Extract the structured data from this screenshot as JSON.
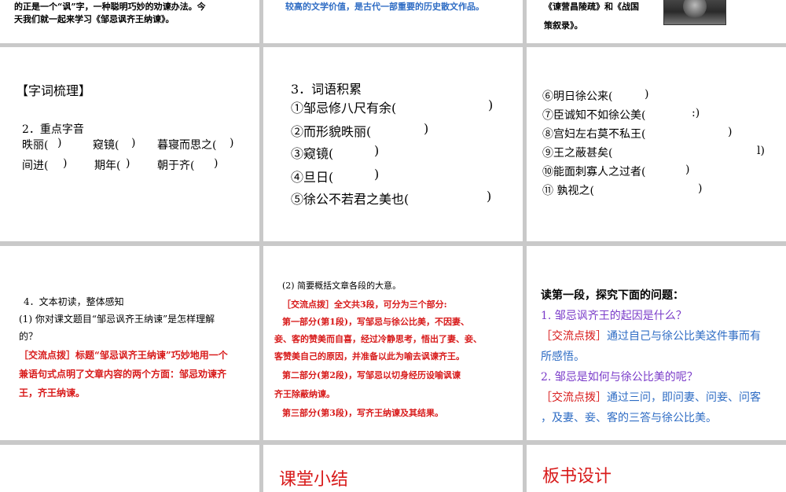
{
  "top_row": {
    "left_line1": "的正是一个“讽”字，一种聪明巧妙的劝谏办法。今",
    "left_line2": "天我们就一起来学习《邹忌讽齐王纳谏》。",
    "middle_line": "较高的文学价值，是古代一部重要的历史散文作品。",
    "right_line1": "《谏营昌陵疏》和《战国",
    "right_line2": "策叙录》。"
  },
  "slide_vocab_left": {
    "heading": "【字词梳理】",
    "sub": "2．重点字音",
    "row1": [
      "昳丽(",
      ")",
      "窥镜(",
      ")",
      "暮寝而思之(",
      ")"
    ],
    "row2": [
      "间进(",
      ")",
      "期年(",
      ")",
      "朝于齐(",
      ")"
    ]
  },
  "slide_vocab_mid": {
    "heading": "3．词语积累",
    "items": [
      "①邹忌修八尺有余(",
      "②而形貌昳丽(",
      "③窥镜(",
      "④旦日(",
      "⑤徐公不若君之美也("
    ],
    "close": ")"
  },
  "slide_vocab_right": {
    "items": [
      "⑥明日徐公来(",
      "⑦臣诚知不如徐公美(",
      "⑧宫妇左右莫不私王(",
      "⑨王之蔽甚矣(",
      "⑩能面刺寡人之过者(",
      "⑪  孰视之("
    ],
    "closes": [
      ")",
      ":)",
      ")",
      "l)",
      ")",
      ")"
    ]
  },
  "slide_reading": {
    "heading": "4．文本初读，整体感知",
    "q1a": "(1) 你对课文题目“邹忌讽齐王纳谏”是怎样理解",
    "q1b": "的？",
    "a1": "［交流点拨］标题“邹忌讽齐王纳谏”巧妙地用一个",
    "a2": "兼语句式点明了文章内容的两个方面：邹忌劝谏齐",
    "a3": "王，齐王纳谏。"
  },
  "slide_summary": {
    "q2": "(2) 简要概括文章各段的大意。",
    "lines": [
      "［交流点拨］全文共3段，可分为三个部分:",
      "第一部分(第1段)，写邹忌与徐公比美，不因妻、",
      "妾、客的赞美而自喜，经过冷静思考，悟出了妻、妾、",
      "客赞美自己的原因，并准备以此为喻去讽谏齐王。",
      "第二部分(第2段)，写邹忌以切身经历设喻讽谏",
      "齐王除蔽纳谏。",
      "第三部分(第3段)，写齐王纳谏及其结果。"
    ]
  },
  "slide_explore": {
    "title": "读第一段，探究下面的问题：",
    "q1": "1. 邹忌讽齐王的起因是什么？",
    "a1_tag": "［交流点拨］",
    "a1_text": "通过自己与徐公比美这件事而有",
    "a1_cont": "所感悟。",
    "q2": "2. 邹忌是如何与徐公比美的呢？",
    "a2_tag": "［交流点拨］",
    "a2_text": "通过三问，即问妻、问妾、问客",
    "a2_cont": "，及妻、妾、客的三答与徐公比美。"
  },
  "bottom_row": {
    "middle_title": "课堂小结",
    "right_title": "板书设计"
  }
}
